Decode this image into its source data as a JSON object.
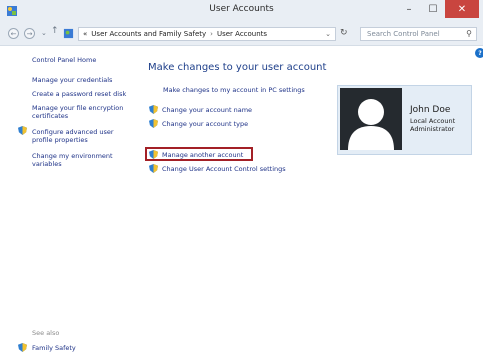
{
  "window": {
    "title": "User Accounts"
  },
  "navigation": {
    "breadcrumb": [
      "«",
      "User Accounts and Family Safety",
      "User Accounts"
    ],
    "search_placeholder": "Search Control Panel"
  },
  "sidebar": {
    "home": "Control Panel Home",
    "items": [
      "Manage your credentials",
      "Create a password reset disk",
      "Manage your file encryption certificates",
      "Configure advanced user profile properties",
      "Change my environment variables"
    ],
    "see_also_label": "See also",
    "family_safety": "Family Safety"
  },
  "main": {
    "heading": "Make changes to your user account",
    "pc_settings_link": "Make changes to my account in PC settings",
    "change_name": "Change your account name",
    "change_type": "Change your account type",
    "manage_another": "Manage another account",
    "uac_settings": "Change User Account Control settings"
  },
  "user_card": {
    "name": "John Doe",
    "type": "Local Account",
    "role": "Administrator"
  },
  "colors": {
    "link": "#1e3287",
    "highlight_border": "#a32026",
    "close_button": "#c9453f",
    "card_bg": "#e4edf6"
  },
  "icons": {
    "app": "control-panel-icon",
    "shield": "uac-shield-icon",
    "help": "help-icon"
  }
}
